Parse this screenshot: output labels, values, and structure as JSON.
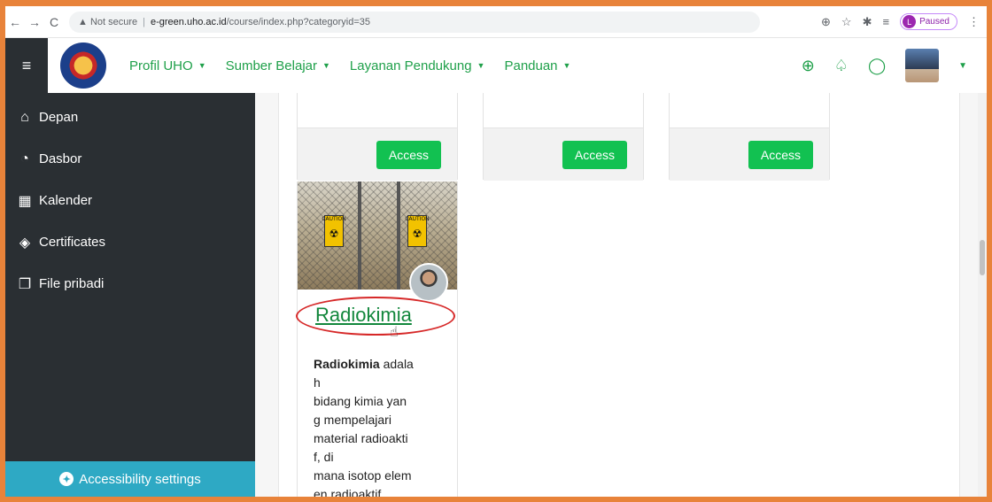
{
  "browser": {
    "back": "←",
    "forward": "→",
    "reload": "C",
    "security_label": "▲ Not secure",
    "separator": "|",
    "url_host": "e-green.uho.ac.id",
    "url_path": "/course/index.php?categoryid=35",
    "zoom_icon": "⊕",
    "star_icon": "☆",
    "extensions_icon": "✱",
    "queue_icon": "≡",
    "profile_initial": "L",
    "paused_label": "Paused",
    "menu_icon": "⋮"
  },
  "header": {
    "hamburger_icon": "≡",
    "nav": [
      {
        "label": "Profil UHO"
      },
      {
        "label": "Sumber Belajar"
      },
      {
        "label": "Layanan Pendukung"
      },
      {
        "label": "Panduan"
      }
    ],
    "caret": "▼",
    "globe_icon": "⊕",
    "bell_icon": "♤",
    "chat_icon": "◯"
  },
  "sidebar": {
    "items": [
      {
        "icon": "⌂",
        "label": "Depan"
      },
      {
        "icon": "◔",
        "label": "Dasbor"
      },
      {
        "icon": "▦",
        "label": "Kalender"
      },
      {
        "icon": "◈",
        "label": "Certificates"
      },
      {
        "icon": "❐",
        "label": "File pribadi"
      }
    ],
    "accessibility_label": "Accessibility settings",
    "accessibility_icon": "✦"
  },
  "cards_top": [
    {
      "button": "Access"
    },
    {
      "button": "Access"
    },
    {
      "button": "Access"
    }
  ],
  "course": {
    "title": "Radiokimia",
    "sign_text": "CAUTION",
    "sign_symbol": "☢",
    "cursor": "☝",
    "desc_bold": "Radiokimia",
    "desc_lines": [
      " adala",
      "h",
      "bidang kimia yan",
      "g mempelajari",
      "material radioakti",
      "f, di",
      "mana isotop elem",
      "en radioaktif"
    ]
  }
}
